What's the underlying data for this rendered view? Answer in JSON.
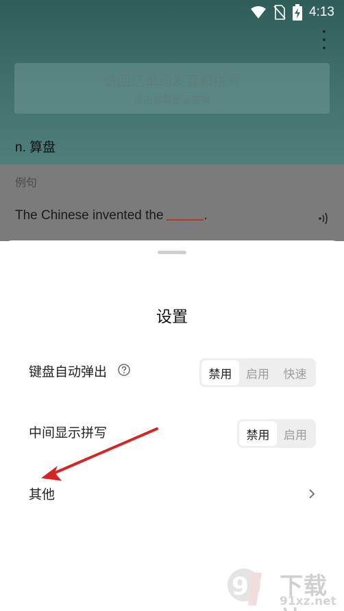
{
  "status_bar": {
    "time": "4:13"
  },
  "header": {
    "hint_title": "请回忆单词发音和拼写",
    "hint_subtitle": "点击屏幕显示答案"
  },
  "word": {
    "meaning": "n. 算盘"
  },
  "example": {
    "label": "例句",
    "sentence_before": "The Chinese invented the",
    "sentence_after": "."
  },
  "settings_sheet": {
    "title": "设置",
    "keyboard_popup": {
      "label": "键盘自动弹出",
      "options": [
        "禁用",
        "启用",
        "快速"
      ],
      "selected": "禁用"
    },
    "middle_spelling": {
      "label": "中间显示拼写",
      "options": [
        "禁用",
        "启用"
      ],
      "selected": "禁用"
    },
    "other": {
      "label": "其他"
    }
  },
  "watermark": {
    "brand": "下载站",
    "url": "91xz.net"
  },
  "colors": {
    "accent": "#2f5e58",
    "arrow": "#d42424",
    "blank": "#b23a2a"
  }
}
